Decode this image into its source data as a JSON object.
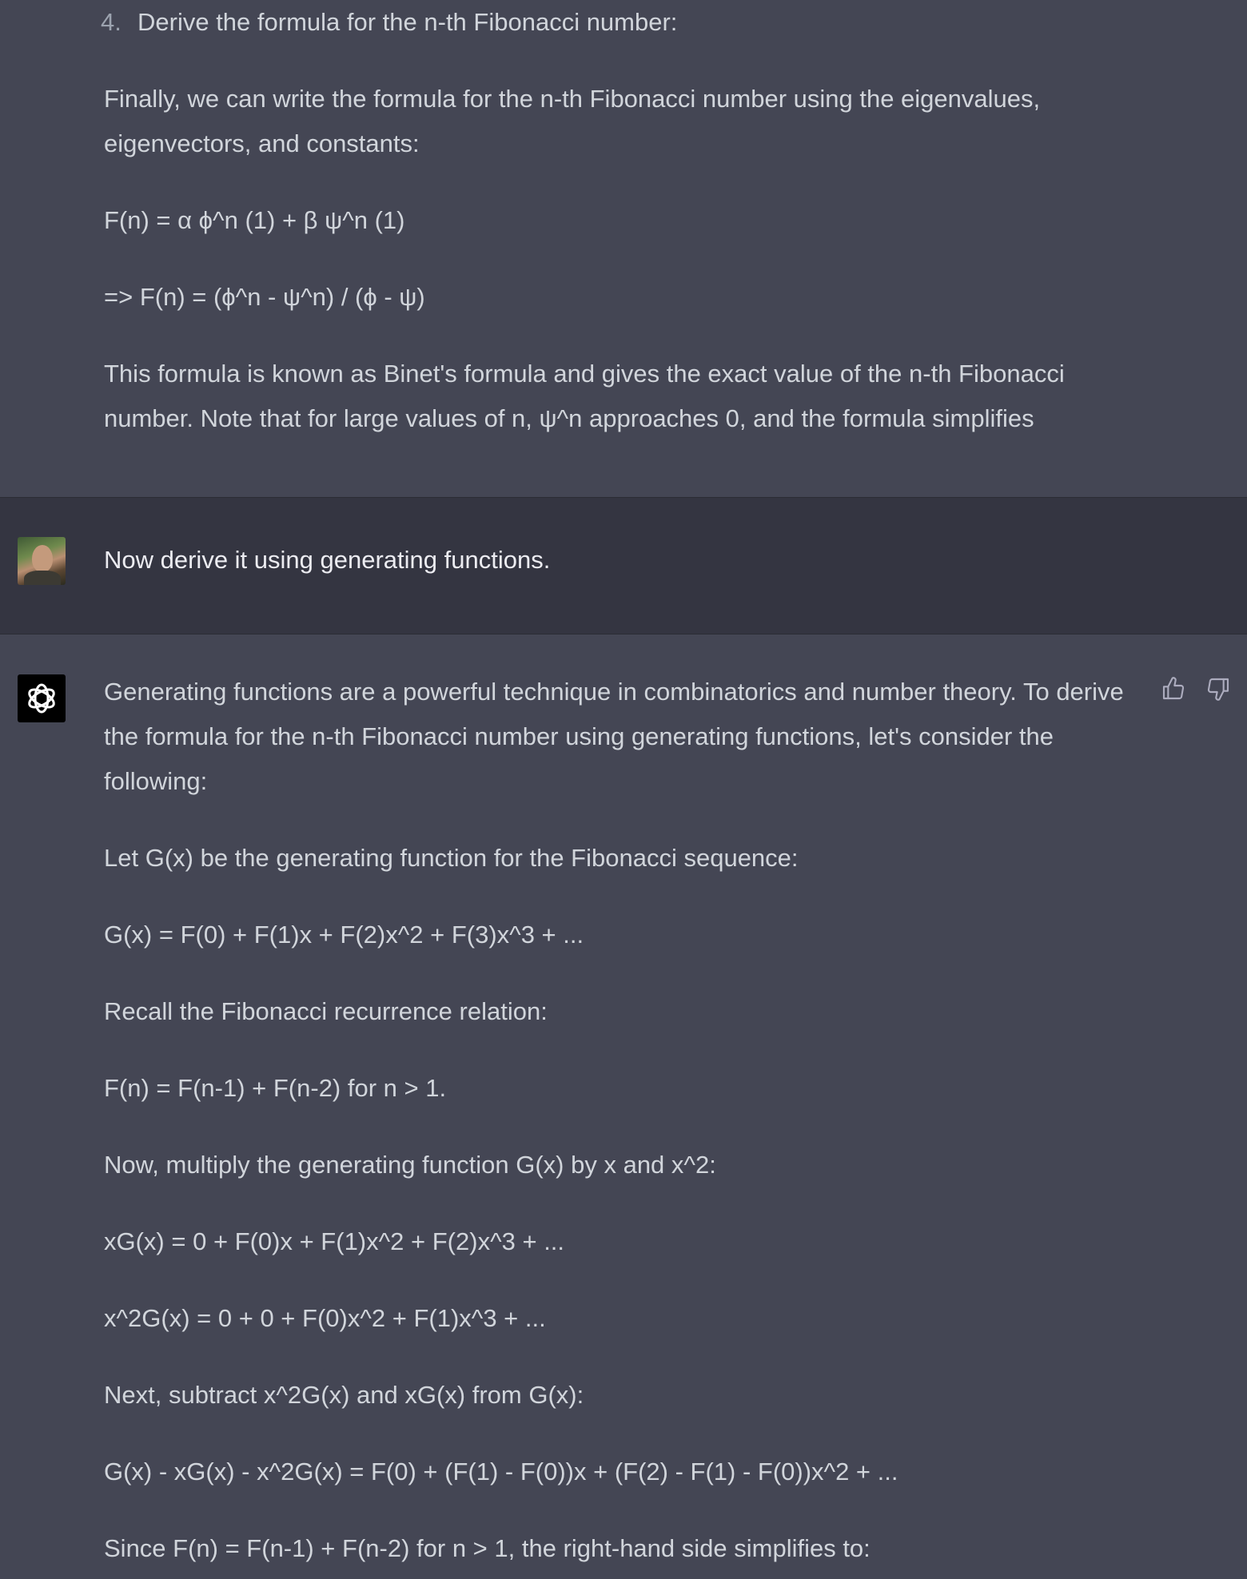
{
  "top_response": {
    "list_item": {
      "number": "4.",
      "text": "Derive the formula for the n-th Fibonacci number:"
    },
    "paragraphs": [
      "Finally, we can write the formula for the n-th Fibonacci number using the eigenvalues, eigenvectors, and constants:",
      "F(n) = α ϕ^n (1) + β ψ^n (1)",
      "=> F(n) = (ϕ^n - ψ^n) / (ϕ - ψ)",
      "This formula is known as Binet's formula and gives the exact value of the n-th Fibonacci number. Note that for large values of n, ψ^n approaches 0, and the formula simplifies"
    ]
  },
  "user_message": {
    "text": "Now derive it using generating functions."
  },
  "assistant_response": {
    "paragraphs": [
      "Generating functions are a powerful technique in combinatorics and number theory. To derive the formula for the n-th Fibonacci number using generating functions, let's consider the following:",
      "Let G(x) be the generating function for the Fibonacci sequence:",
      "G(x) = F(0) + F(1)x + F(2)x^2 + F(3)x^3 + ...",
      "Recall the Fibonacci recurrence relation:",
      "F(n) = F(n-1) + F(n-2) for n > 1.",
      "Now, multiply the generating function G(x) by x and x^2:",
      "xG(x) = 0 + F(0)x + F(1)x^2 + F(2)x^3 + ...",
      "x^2G(x) = 0 + 0 + F(0)x^2 + F(1)x^3 + ...",
      "Next, subtract x^2G(x) and xG(x) from G(x):",
      "G(x) - xG(x) - x^2G(x) = F(0) + (F(1) - F(0))x + (F(2) - F(1) - F(0))x^2 + ...",
      "Since F(n) = F(n-1) + F(n-2) for n > 1, the right-hand side simplifies to:"
    ]
  },
  "icons": {
    "user_avatar": "user-avatar",
    "assistant_avatar": "openai-logo-icon",
    "thumbs_up": "thumbs-up-icon",
    "thumbs_down": "thumbs-down-icon"
  },
  "colors": {
    "assistant_bg": "#444654",
    "user_bg": "#343541",
    "text": "#d1d5db"
  }
}
